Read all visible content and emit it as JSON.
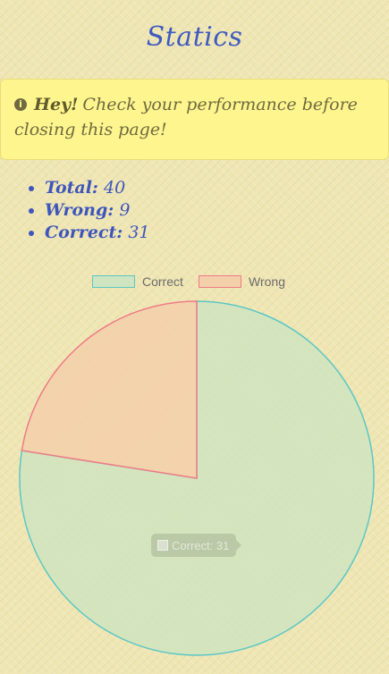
{
  "page": {
    "title": "Statics"
  },
  "alert": {
    "icon": "info-icon",
    "icon_glyph": "i",
    "strong": "Hey!",
    "message": "Check your performance before closing this page!"
  },
  "stats": [
    {
      "label": "Total:",
      "value": "40"
    },
    {
      "label": "Wrong:",
      "value": "9"
    },
    {
      "label": "Correct:",
      "value": "31"
    }
  ],
  "legend": [
    {
      "label": "Correct",
      "stroke": "#5bc7c4",
      "fill": "#cfe4c0"
    },
    {
      "label": "Wrong",
      "stroke": "#ef7b86",
      "fill": "#f3cfaa"
    }
  ],
  "tooltip": {
    "text": "Correct: 31"
  },
  "chart_data": {
    "type": "pie",
    "categories": [
      "Correct",
      "Wrong"
    ],
    "values": [
      31,
      9
    ],
    "colors": {
      "Correct": {
        "fill": "#cfe4c0",
        "stroke": "#5bc7c4"
      },
      "Wrong": {
        "fill": "#f3cfaa",
        "stroke": "#ef7b86"
      }
    },
    "legend_position": "top"
  }
}
